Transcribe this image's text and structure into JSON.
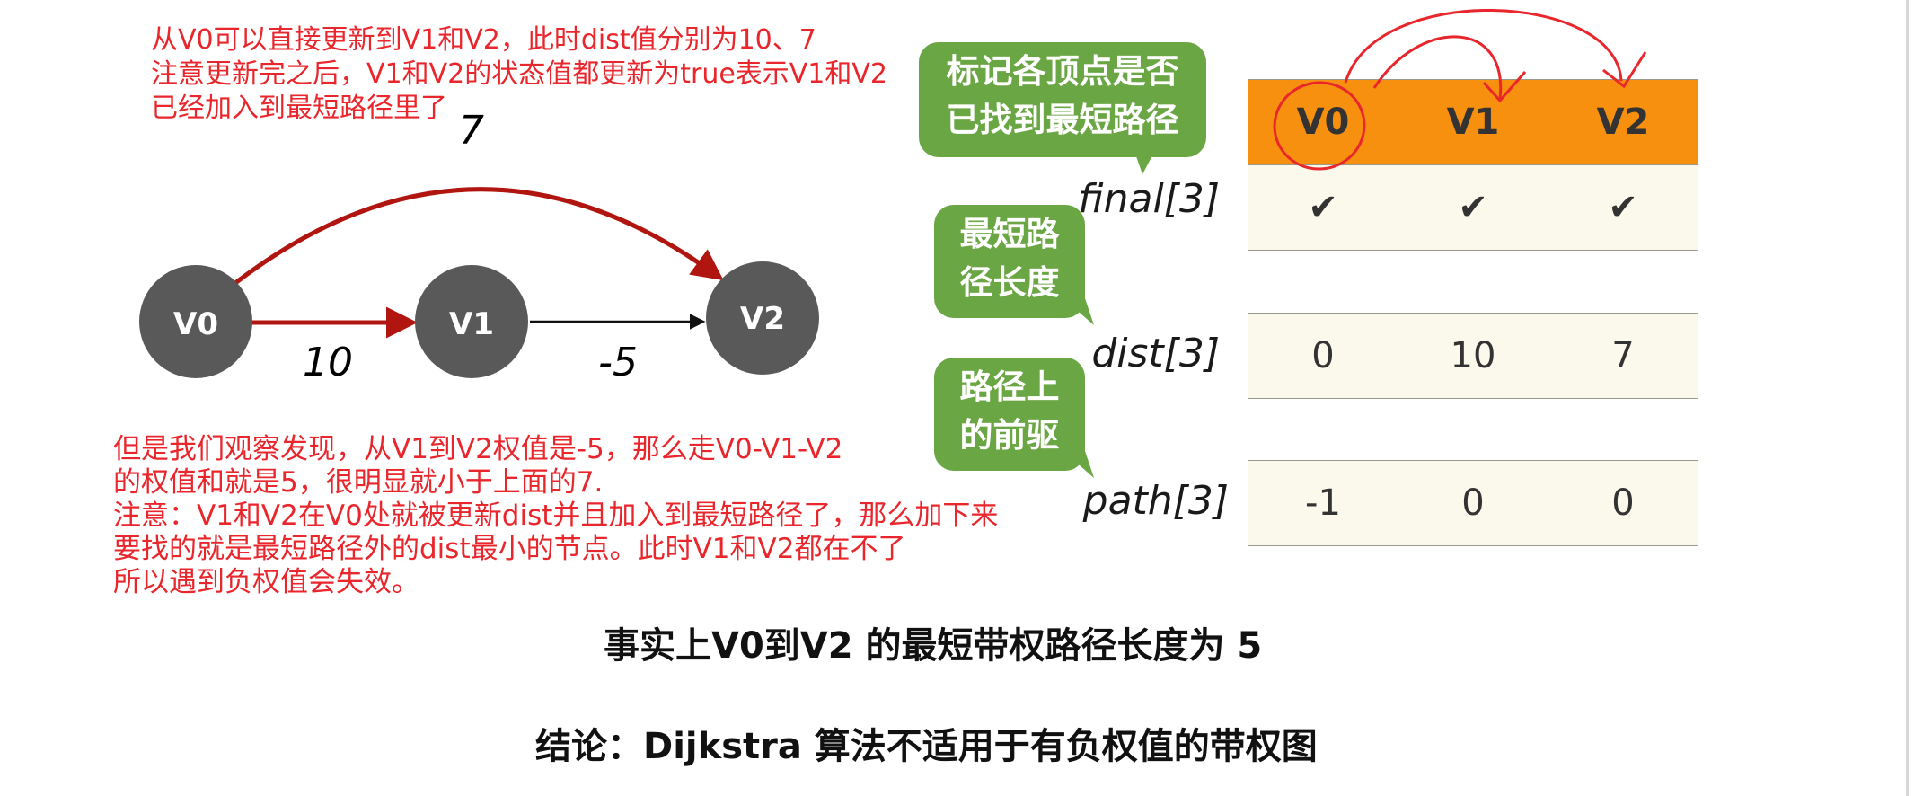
{
  "notes": {
    "top_line1": "从V0可以直接更新到V1和V2，此时dist值分别为10、7",
    "top_line2": "注意更新完之后，V1和V2的状态值都更新为true表示V1和V2",
    "top_line3": "已经加入到最短路径里了",
    "bottom_line1": "但是我们观察发现，从V1到V2权值是-5，那么走V0-V1-V2",
    "bottom_line2": "的权值和就是5，很明显就小于上面的7.",
    "bottom_line3": "注意：V1和V2在V0处就被更新dist并且加入到最短路径了，那么加下来",
    "bottom_line4": "要找的就是最短路径外的dist最小的节点。此时V1和V2都在不了",
    "bottom_line5": "所以遇到负权值会失效。"
  },
  "graph": {
    "nodes": [
      "V0",
      "V1",
      "V2"
    ],
    "edges": [
      {
        "from": "V0",
        "to": "V1",
        "weight": "10"
      },
      {
        "from": "V1",
        "to": "V2",
        "weight": "-5"
      },
      {
        "from": "V0",
        "to": "V2",
        "weight": "7"
      }
    ],
    "node_color": "#595959",
    "highlight_edge_color": "#b0150f"
  },
  "bubbles": {
    "final_line1": "标记各顶点是否",
    "final_line2": "已找到最短路径",
    "dist_line1": "最短路",
    "dist_line2": "径长度",
    "path_line1": "路径上",
    "path_line2": "的前驱"
  },
  "table": {
    "headers": [
      "V0",
      "V1",
      "V2"
    ],
    "final_label": "final[3]",
    "final_values": [
      "✔",
      "✔",
      "✔"
    ],
    "dist_label": "dist[3]",
    "dist_values": [
      "0",
      "10",
      "7"
    ],
    "path_label": "path[3]",
    "path_values": [
      "-1",
      "0",
      "0"
    ],
    "header_color": "#f7900f"
  },
  "statements": {
    "fact": "事实上V0到V2 的最短带权路径长度为 5",
    "conclusion": "结论：Dijkstra 算法不适用于有负权值的带权图"
  }
}
